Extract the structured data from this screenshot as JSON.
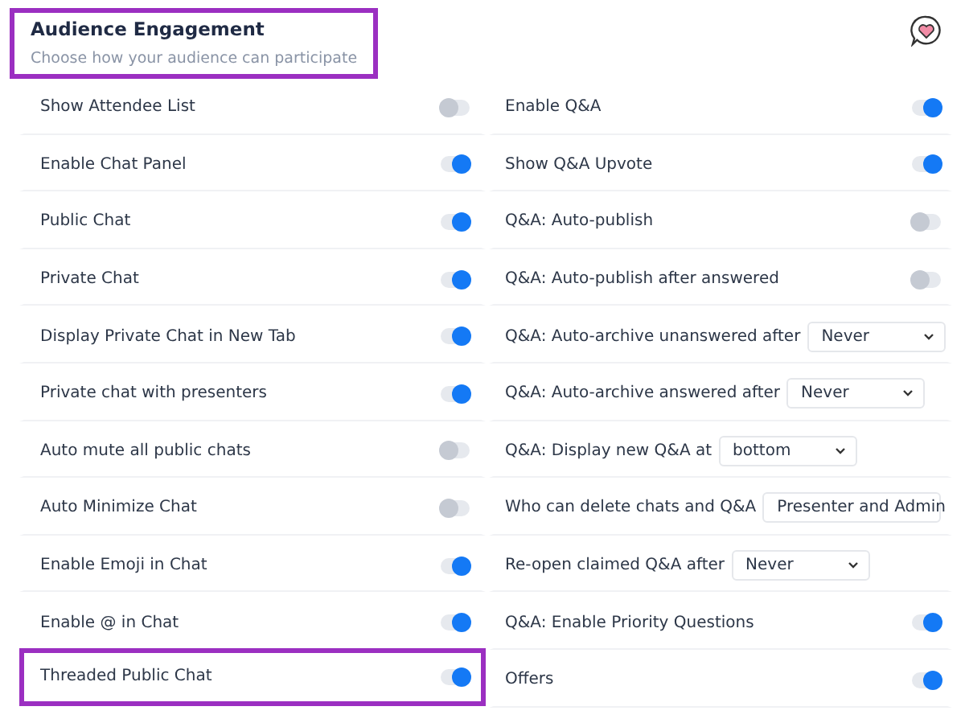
{
  "header": {
    "title": "Audience Engagement",
    "subtitle": "Choose how your audience can participate",
    "highlighted": true
  },
  "left": [
    {
      "label": "Show Attendee List",
      "on": false,
      "highlighted": false
    },
    {
      "label": "Enable Chat Panel",
      "on": true,
      "highlighted": false
    },
    {
      "label": "Public Chat",
      "on": true,
      "highlighted": false
    },
    {
      "label": "Private Chat",
      "on": true,
      "highlighted": false
    },
    {
      "label": "Display Private Chat in New Tab",
      "on": true,
      "highlighted": false
    },
    {
      "label": "Private chat with presenters",
      "on": true,
      "highlighted": false
    },
    {
      "label": "Auto mute all public chats",
      "on": false,
      "highlighted": false
    },
    {
      "label": "Auto Minimize Chat",
      "on": false,
      "highlighted": false
    },
    {
      "label": "Enable Emoji in Chat",
      "on": true,
      "highlighted": false
    },
    {
      "label": "Enable @ in Chat",
      "on": true,
      "highlighted": false
    },
    {
      "label": "Threaded Public Chat",
      "on": true,
      "highlighted": true
    }
  ],
  "right": [
    {
      "kind": "toggle",
      "label": "Enable Q&A",
      "on": true
    },
    {
      "kind": "toggle",
      "label": "Show Q&A Upvote",
      "on": true
    },
    {
      "kind": "toggle",
      "label": "Q&A: Auto-publish",
      "on": false
    },
    {
      "kind": "toggle",
      "label": "Q&A: Auto-publish after answered",
      "on": false
    },
    {
      "kind": "select",
      "label": "Q&A: Auto-archive unanswered after",
      "value": "Never"
    },
    {
      "kind": "select",
      "label": "Q&A: Auto-archive answered after",
      "value": "Never"
    },
    {
      "kind": "select",
      "label": "Q&A: Display new Q&A at",
      "value": "bottom"
    },
    {
      "kind": "select",
      "label": "Who can delete chats and Q&A",
      "value": "Presenter and Admin"
    },
    {
      "kind": "select",
      "label": "Re-open claimed Q&A after",
      "value": "Never"
    },
    {
      "kind": "toggle",
      "label": "Q&A: Enable Priority Questions",
      "on": true
    },
    {
      "kind": "toggle",
      "label": "Offers",
      "on": true
    }
  ]
}
